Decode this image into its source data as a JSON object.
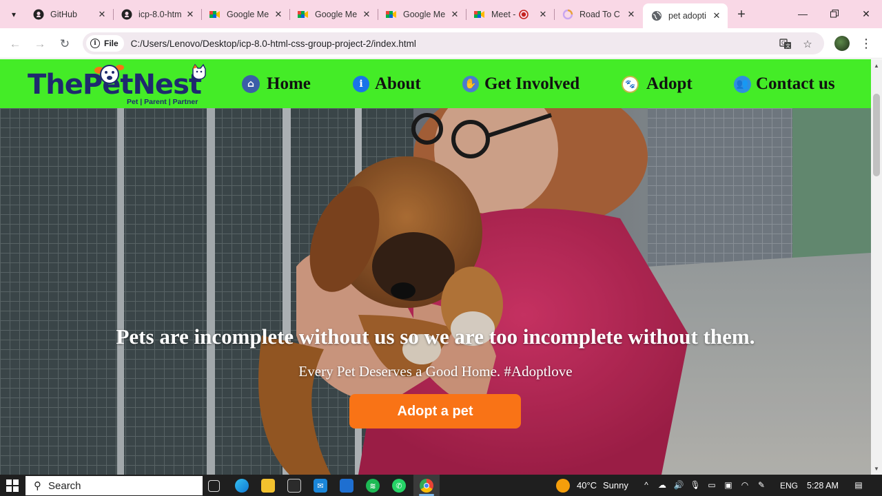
{
  "browser": {
    "tabs": [
      {
        "title": "GitHub",
        "icon": "github-icon"
      },
      {
        "title": "icp-8.0-htm",
        "icon": "github-icon"
      },
      {
        "title": "Google Me",
        "icon": "google-meet-icon"
      },
      {
        "title": "Google Me",
        "icon": "google-meet-icon"
      },
      {
        "title": "Google Me",
        "icon": "google-meet-icon"
      },
      {
        "title": "Meet -",
        "icon": "google-meet-icon"
      },
      {
        "title": "Road To C",
        "icon": "loading-icon"
      },
      {
        "title": "pet adopti",
        "icon": "globe-icon"
      }
    ],
    "address": {
      "scheme_label": "File",
      "url": "C:/Users/Lenovo/Desktop/icp-8.0-html-css-group-project-2/index.html"
    }
  },
  "site": {
    "logo": {
      "name": "ThePetNest",
      "tagline": "Pet | Parent | Partner"
    },
    "nav": [
      {
        "label": "Home",
        "icon": "home-icon"
      },
      {
        "label": "About",
        "icon": "info-icon"
      },
      {
        "label": "Get Involved",
        "icon": "hands-icon"
      },
      {
        "label": "Adopt",
        "icon": "paw-badge-icon"
      },
      {
        "label": "Contact us",
        "icon": "contact-people-icon"
      }
    ],
    "hero": {
      "headline": "Pets are incomplete without us so we are too incomplete without them.",
      "subheadline": "Every Pet Deserves a Good Home. #Adoptlove",
      "cta_label": "Adopt a pet"
    },
    "colors": {
      "nav_bg": "#44ec27",
      "logo_text": "#1e2a6e",
      "cta_bg": "#f97316"
    }
  },
  "taskbar": {
    "search_label": "Search",
    "weather": {
      "temp": "40°C",
      "condition": "Sunny"
    },
    "language": "ENG",
    "time": "5:28 AM"
  }
}
